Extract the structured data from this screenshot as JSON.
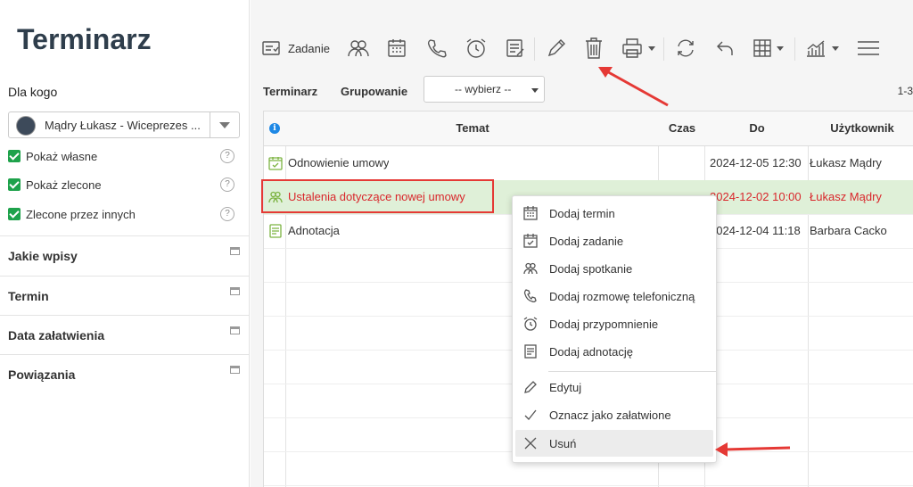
{
  "sidebar": {
    "app_title": "Terminarz",
    "for_whom_label": "Dla kogo",
    "user_select_value": "Mądry Łukasz - Wiceprezes ...",
    "checks": [
      {
        "label": "Pokaż własne",
        "checked": true
      },
      {
        "label": "Pokaż zlecone",
        "checked": true
      },
      {
        "label": "Zlecone przez innych",
        "checked": true
      }
    ],
    "help_glyph": "?",
    "sections": [
      {
        "title": "Jakie wpisy"
      },
      {
        "title": "Termin"
      },
      {
        "title": "Data załatwienia"
      },
      {
        "title": "Powiązania"
      }
    ]
  },
  "toolbar": {
    "task_label": "Zadanie"
  },
  "filterbar": {
    "calendar_label": "Terminarz",
    "grouping_label": "Grupowanie",
    "grouping_value": "-- wybierz --",
    "page_info": "1-3"
  },
  "grid": {
    "info_glyph": "i",
    "columns": [
      "Temat",
      "Czas",
      "Do",
      "Użytkownik"
    ],
    "rows": [
      {
        "icon": "task-icon",
        "subject": "Odnowienie umowy",
        "time": "",
        "due": "2024-12-05 12:30",
        "user": "Łukasz Mądry",
        "selected": false
      },
      {
        "icon": "meeting-icon",
        "subject": "Ustalenia dotyczące nowej umowy",
        "time": "",
        "due": "2024-12-02 10:00",
        "user": "Łukasz Mądry",
        "selected": true
      },
      {
        "icon": "note-icon",
        "subject": "Adnotacja",
        "time": "",
        "due": "2024-12-04 11:18",
        "user": "Barbara Cacko",
        "selected": false
      }
    ]
  },
  "context_menu": {
    "items": [
      {
        "label": "Dodaj termin",
        "icon": "calendar-icon"
      },
      {
        "label": "Dodaj zadanie",
        "icon": "task-icon"
      },
      {
        "label": "Dodaj spotkanie",
        "icon": "meeting-icon"
      },
      {
        "label": "Dodaj rozmowę telefoniczną",
        "icon": "phone-icon"
      },
      {
        "label": "Dodaj przypomnienie",
        "icon": "alarm-clock-icon"
      },
      {
        "label": "Dodaj adnotację",
        "icon": "note-icon"
      },
      {
        "label": "Edytuj",
        "icon": "pencil-icon"
      },
      {
        "label": "Oznacz jako załatwione",
        "icon": "checkmark-icon"
      },
      {
        "label": "Usuń",
        "icon": "close-icon"
      }
    ]
  },
  "colors": {
    "selected_row_bg": "#dff0d8",
    "selected_row_text": "#d9262b",
    "annotation_red": "#e53935",
    "checkbox_green": "#1ea24b",
    "icon_green": "#7cb342"
  }
}
